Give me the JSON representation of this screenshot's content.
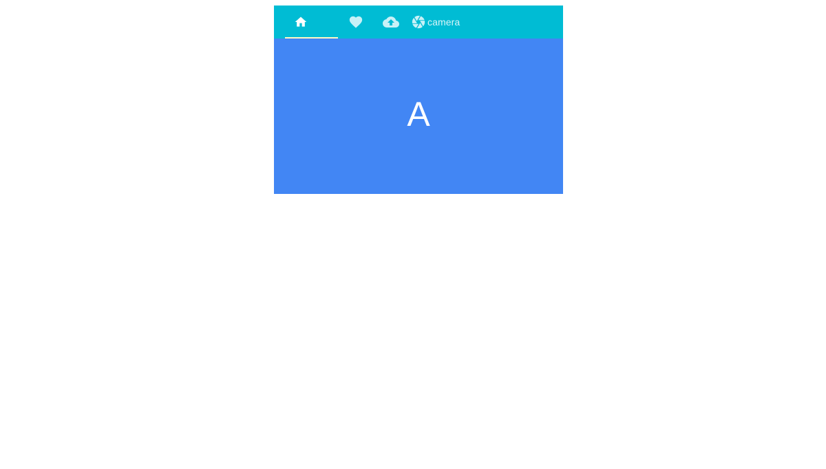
{
  "tabs": [
    {
      "id": "home",
      "icon": "home-icon",
      "label": "",
      "selected": true
    },
    {
      "id": "favorite",
      "icon": "heart-icon",
      "label": "",
      "selected": false
    },
    {
      "id": "upload",
      "icon": "cloud-upload-icon",
      "label": "",
      "selected": false
    },
    {
      "id": "camera",
      "icon": "camera-shutter-icon",
      "label": "camera",
      "selected": false
    }
  ],
  "panel": {
    "content": "A"
  },
  "colors": {
    "tabbar_background": "#00BCD4",
    "ink_bar": "#FFF9C4",
    "panel_background": "#4286F4",
    "icon_selected": "#FFFFFF",
    "icon_unselected": "#C8F1F7"
  }
}
